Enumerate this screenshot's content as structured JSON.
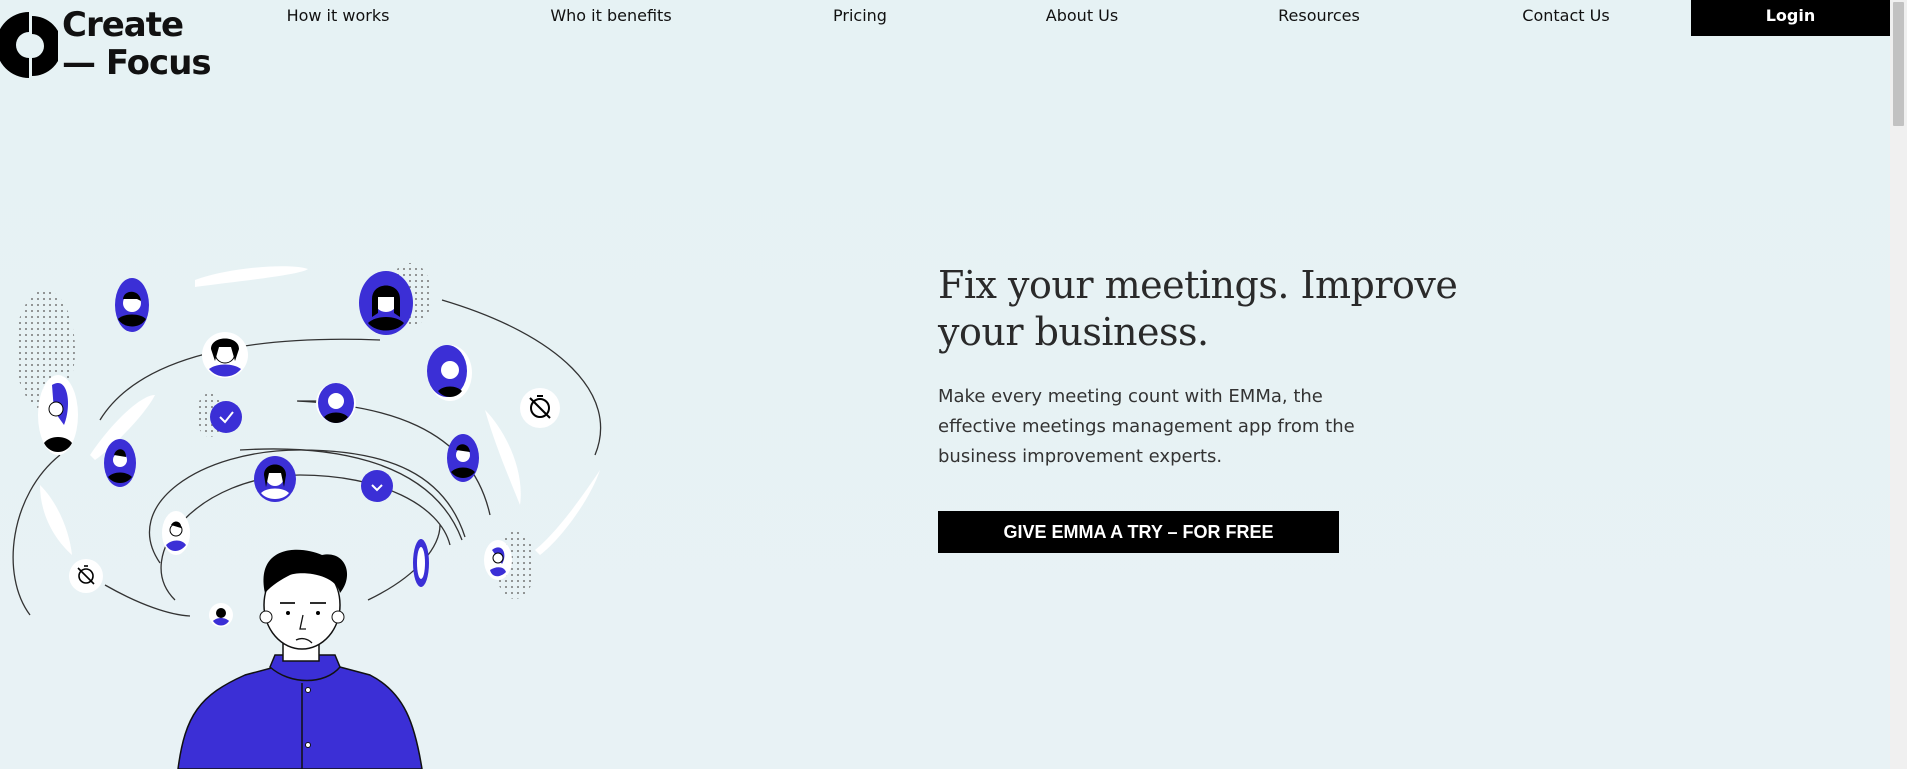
{
  "brand": {
    "line1": "Create",
    "line2": "— Focus",
    "accent": "#3b2fd6"
  },
  "nav": {
    "items": [
      "How it works",
      "Who it benefits",
      "Pricing",
      "About Us",
      "Resources",
      "Contact Us"
    ],
    "login": "Login"
  },
  "hero": {
    "title": "Fix your meetings. Improve your business.",
    "subtitle": "Make every meeting count with EMMa, the effective meetings management app from the business improvement experts.",
    "cta": "GIVE EMMA A TRY – FOR FREE"
  },
  "colors": {
    "background": "#e6f2f4",
    "accent": "#3b2fd6",
    "button": "#000000"
  }
}
